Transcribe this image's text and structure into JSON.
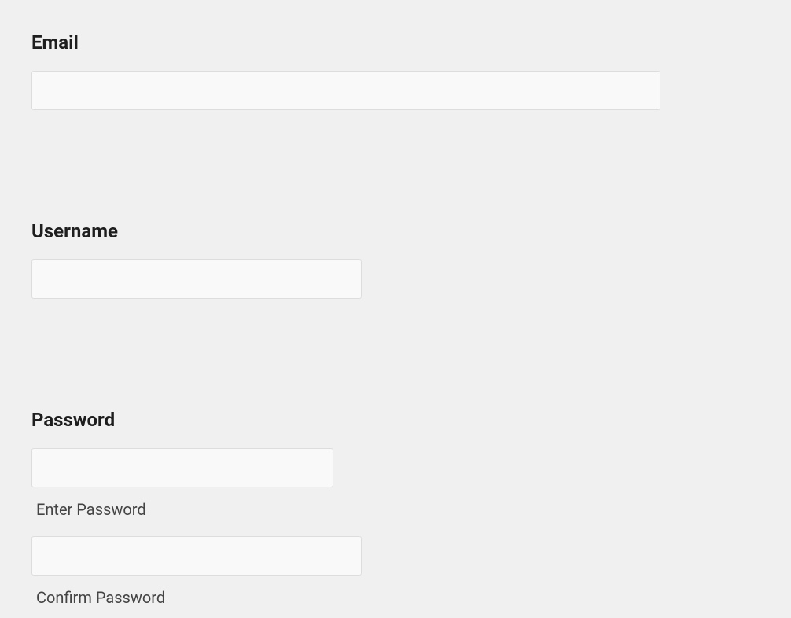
{
  "form": {
    "email": {
      "label": "Email",
      "value": ""
    },
    "username": {
      "label": "Username",
      "value": ""
    },
    "password": {
      "label": "Password",
      "value": "",
      "helper": "Enter Password"
    },
    "confirmPassword": {
      "value": "",
      "helper": "Confirm Password"
    }
  }
}
